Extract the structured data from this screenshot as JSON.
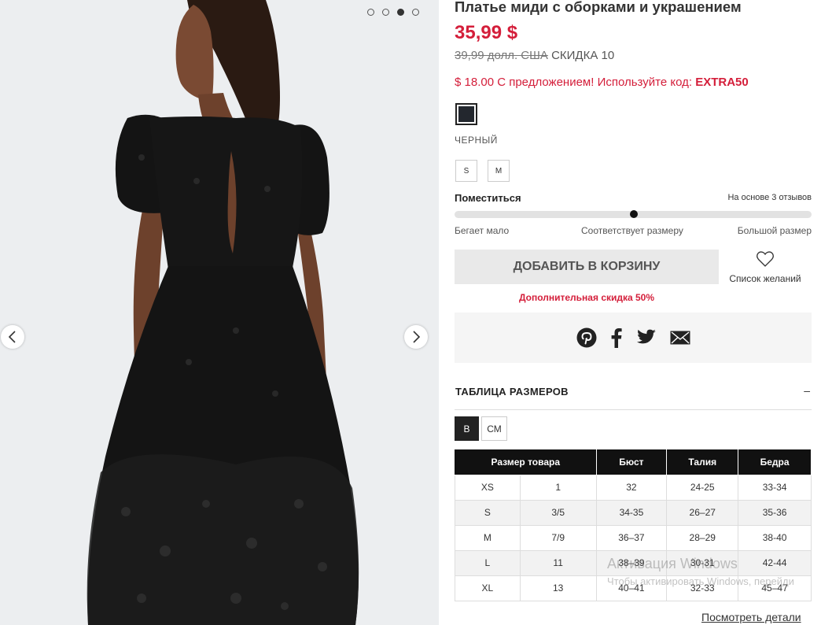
{
  "gallery": {
    "dot_count": 4,
    "active_dot_index": 2
  },
  "product": {
    "title": "Платье миди с оборками и украшением",
    "price": "35,99 $",
    "old_price": "39,99 долл. США",
    "discount": "СКИДКА 10",
    "promo_text": "$ 18.00 С предложением! Используйте код: ",
    "promo_code": "EXTRA50",
    "color_name": "ЧЕРНЫЙ",
    "swatch_color": "#23272e",
    "sizes": [
      "S",
      "M"
    ]
  },
  "fit": {
    "title": "Поместиться",
    "reviews": "На основе 3 отзывов",
    "level": 0.5,
    "label_left": "Бегает мало",
    "label_center": "Соответствует размеру",
    "label_right": "Большой размер"
  },
  "actions": {
    "add_to_cart": "ДОБАВИТЬ В КОРЗИНУ",
    "wishlist": "Список желаний",
    "extra_discount": "Дополнительная скидка 50%"
  },
  "share": {
    "icons": [
      "pinterest-icon",
      "facebook-icon",
      "twitter-icon",
      "email-icon"
    ]
  },
  "size_chart": {
    "title": "ТАБЛИЦА РАЗМЕРОВ",
    "collapse_symbol": "–",
    "units": [
      "В",
      "СМ"
    ],
    "active_unit": "В",
    "headers": [
      "Размер товара",
      "Бюст",
      "Талия",
      "Бедра"
    ],
    "rows": [
      [
        "XS",
        "1",
        "32",
        "24-25",
        "33-34"
      ],
      [
        "S",
        "3/5",
        "34-35",
        "26–27",
        "35-36"
      ],
      [
        "M",
        "7/9",
        "36–37",
        "28–29",
        "38-40"
      ],
      [
        "L",
        "11",
        "38–39",
        "30-31",
        "42-44"
      ],
      [
        "XL",
        "13",
        "40–41",
        "32-33",
        "45–47"
      ]
    ],
    "view_details": "Посмотреть детали"
  },
  "watermark": {
    "line1": "Активация Windows",
    "line2": "Чтобы активировать Windows, перейди"
  },
  "colors": {
    "accent_red": "#d41e3a",
    "dress_black": "#141414"
  }
}
